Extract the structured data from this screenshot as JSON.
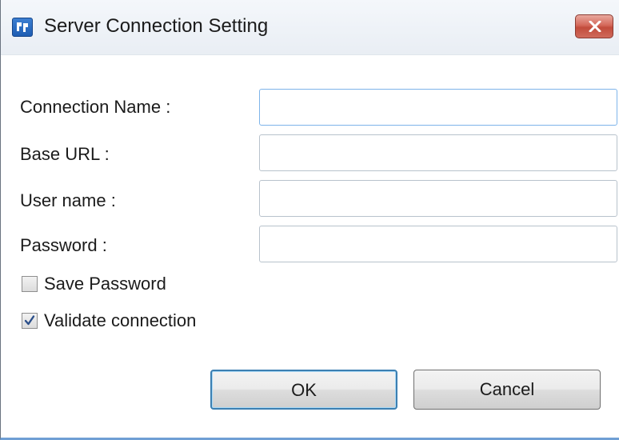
{
  "window": {
    "title": "Server Connection Setting"
  },
  "form": {
    "fields": [
      {
        "label": "Connection Name :",
        "value": "",
        "placeholder": ""
      },
      {
        "label": "Base URL :",
        "value": "",
        "placeholder": ""
      },
      {
        "label": "User name :",
        "value": "",
        "placeholder": ""
      },
      {
        "label": "Password :",
        "value": "",
        "placeholder": ""
      }
    ],
    "checkboxes": [
      {
        "label": "Save Password",
        "checked": false
      },
      {
        "label": "Validate connection",
        "checked": true
      }
    ]
  },
  "buttons": {
    "ok_label": "OK",
    "cancel_label": "Cancel"
  },
  "colors": {
    "focus_border": "#7eb4ea",
    "default_button_border": "#3c7fb1",
    "close_button": "#c24c3c",
    "check_mark": "#2b4f8a"
  },
  "icons": {
    "app": "app-logo-icon",
    "close": "close-icon",
    "check": "checkmark-icon"
  }
}
